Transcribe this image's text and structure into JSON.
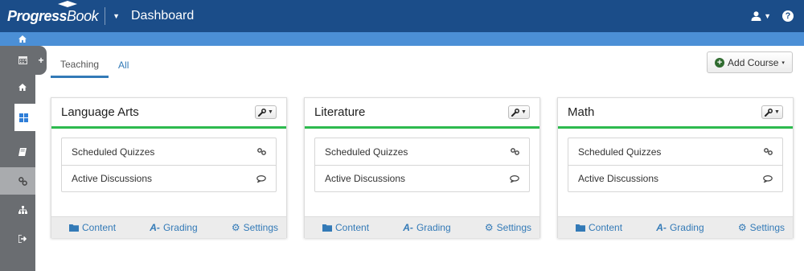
{
  "topbar": {
    "logo_primary": "Progress",
    "logo_secondary": "Book",
    "title": "Dashboard",
    "menu_caret": "▼",
    "user_caret": "▼",
    "help_glyph": "?"
  },
  "sidebar": {
    "add_glyph": "+",
    "items": [
      {
        "icon": "calendar-icon"
      },
      {
        "icon": "home-icon"
      },
      {
        "icon": "grid-icon",
        "active": true
      },
      {
        "icon": "book-icon"
      },
      {
        "icon": "link-icon"
      },
      {
        "icon": "sitemap-icon"
      },
      {
        "icon": "sign-out-icon"
      }
    ]
  },
  "breadcrumb": {
    "icon": "home-icon"
  },
  "tabs": [
    {
      "label": "Teaching",
      "active": true
    },
    {
      "label": "All",
      "active": false
    }
  ],
  "add_course": {
    "label": "Add Course",
    "caret": "▾"
  },
  "colors": {
    "brand": "#1b4d89",
    "subbar": "#4b8fd6",
    "accent": "#2dba4e",
    "link": "#337ab7",
    "sidebar": "#6a6d71"
  },
  "courses": [
    {
      "title": "Language Arts",
      "rows": [
        {
          "label": "Scheduled Quizzes",
          "icon": "link-icon"
        },
        {
          "label": "Active Discussions",
          "icon": "comment-icon"
        }
      ],
      "footer": {
        "content": "Content",
        "grading": "Grading",
        "settings": "Settings"
      }
    },
    {
      "title": "Literature",
      "rows": [
        {
          "label": "Scheduled Quizzes",
          "icon": "link-icon"
        },
        {
          "label": "Active Discussions",
          "icon": "comment-icon"
        }
      ],
      "footer": {
        "content": "Content",
        "grading": "Grading",
        "settings": "Settings"
      }
    },
    {
      "title": "Math",
      "rows": [
        {
          "label": "Scheduled Quizzes",
          "icon": "link-icon"
        },
        {
          "label": "Active Discussions",
          "icon": "comment-icon"
        }
      ],
      "footer": {
        "content": "Content",
        "grading": "Grading",
        "settings": "Settings"
      }
    }
  ]
}
